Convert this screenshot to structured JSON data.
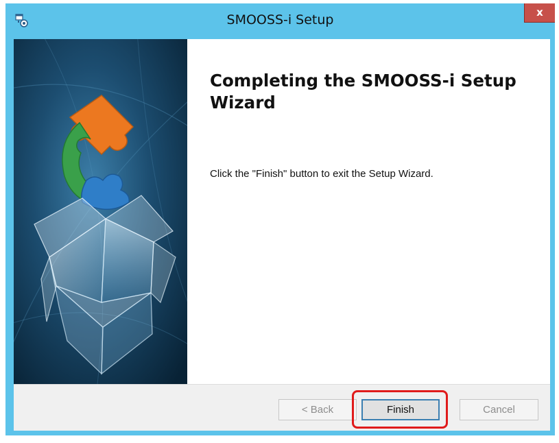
{
  "window": {
    "title": "SMOOSS-i Setup",
    "close_label": "x"
  },
  "content": {
    "heading": "Completing the SMOOSS-i Setup Wizard",
    "body": "Click the \"Finish\" button to exit the Setup Wizard."
  },
  "footer": {
    "back_label": "< Back",
    "finish_label": "Finish",
    "cancel_label": "Cancel"
  },
  "colors": {
    "title_bar": "#5cc3ea",
    "close_button": "#c7504a",
    "highlight": "#e01b1b",
    "banner_dark": "#0a2a40",
    "puzzle_orange": "#ec7820",
    "puzzle_green": "#3aa04a",
    "puzzle_blue": "#2f7ec8"
  },
  "icons": {
    "app": "installer-icon",
    "banner": "puzzle-box-graphic"
  }
}
